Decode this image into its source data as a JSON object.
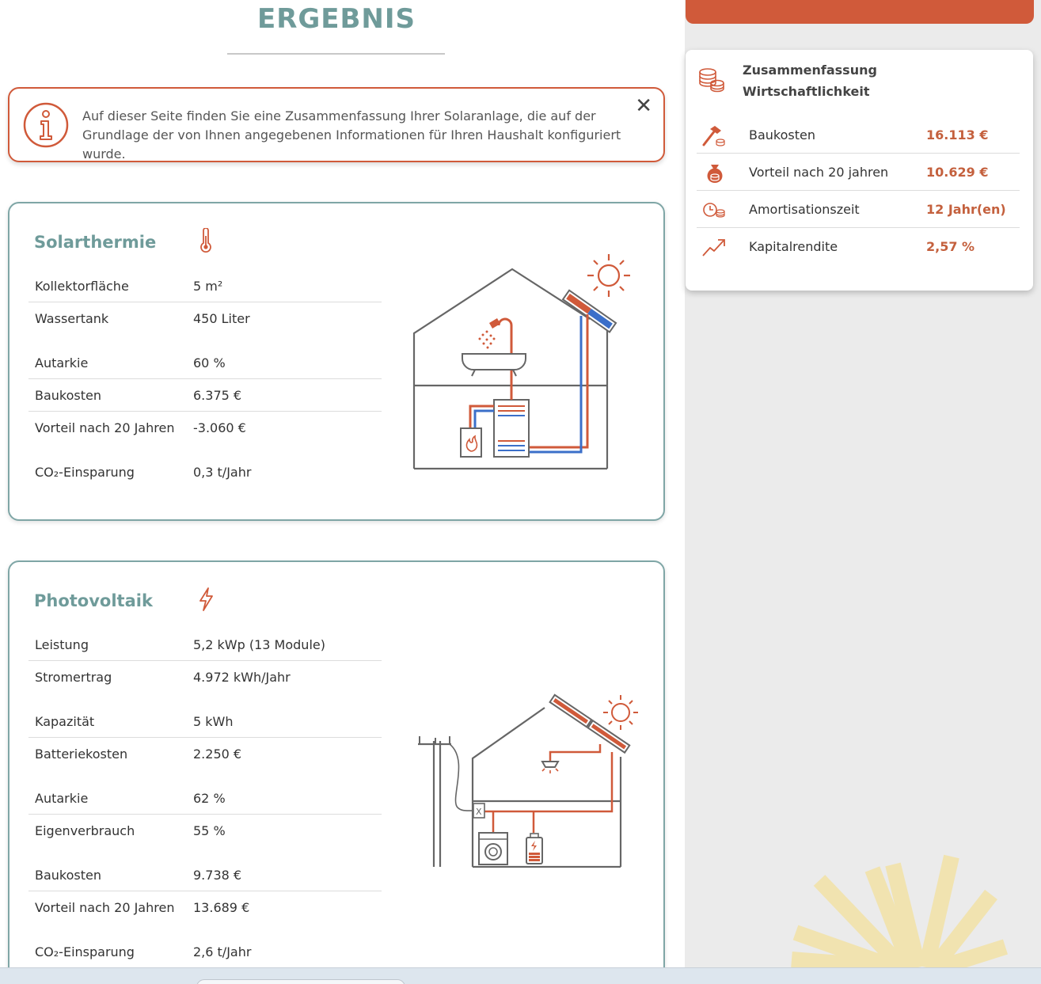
{
  "page": {
    "title": "ERGEBNIS"
  },
  "info": {
    "text": "Auf dieser Seite finden Sie eine Zusammenfassung Ihrer Solaranlage, die auf der Grundlage der von Ihnen angegebenen Informationen für Ihren Haushalt konfiguriert wurde.",
    "close": "✕"
  },
  "solar": {
    "title": "Solarthermie",
    "icon": "thermometer-icon",
    "rows": [
      {
        "label": "Kollektorfläche",
        "value": "5 m²"
      },
      {
        "label": "Wassertank",
        "value": "450 Liter"
      },
      {
        "label": "Autarkie",
        "value": "60 %"
      },
      {
        "label": "Baukosten",
        "value": "6.375 €"
      },
      {
        "label": "Vorteil nach 20 Jahren",
        "value": "-3.060 €"
      },
      {
        "label": "CO₂-Einsparung",
        "value": "0,3 t/Jahr"
      }
    ]
  },
  "pv": {
    "title": "Photovoltaik",
    "icon": "lightning-icon",
    "rows": [
      {
        "label": "Leistung",
        "value": "5,2 kWp (13 Module)"
      },
      {
        "label": "Stromertrag",
        "value": "4.972 kWh/Jahr"
      },
      {
        "label": "Kapazität",
        "value": "5 kWh"
      },
      {
        "label": "Batteriekosten",
        "value": "2.250 €"
      },
      {
        "label": "Autarkie",
        "value": "62 %"
      },
      {
        "label": "Eigenverbrauch",
        "value": "55 %"
      },
      {
        "label": "Baukosten",
        "value": "9.738 €"
      },
      {
        "label": "Vorteil nach 20 Jahren",
        "value": "13.689 €"
      },
      {
        "label": "CO₂-Einsparung",
        "value": "2,6 t/Jahr"
      }
    ]
  },
  "summary": {
    "title": "Zusammenfassung Wirtschaftlichkeit",
    "icon": "coins-icon",
    "rows": [
      {
        "label": "Baukosten",
        "value": "16.113 €",
        "icon": "hammer-icon"
      },
      {
        "label": "Vorteil nach 20 jahren",
        "value": "10.629 €",
        "icon": "money-bag-icon"
      },
      {
        "label": "Amortisationszeit",
        "value": "12 Jahr(en)",
        "icon": "clock-coins-icon"
      },
      {
        "label": "Kapitalrendite",
        "value": "2,57 %",
        "icon": "trend-up-icon"
      }
    ]
  },
  "colors": {
    "accent": "#d05a3a",
    "teal": "#6f9b9a",
    "value_highlight": "#c4603d",
    "pipe_hot": "#d05a3a",
    "pipe_cold": "#3b6fc9",
    "sun_decor": "#f1e3b0"
  }
}
